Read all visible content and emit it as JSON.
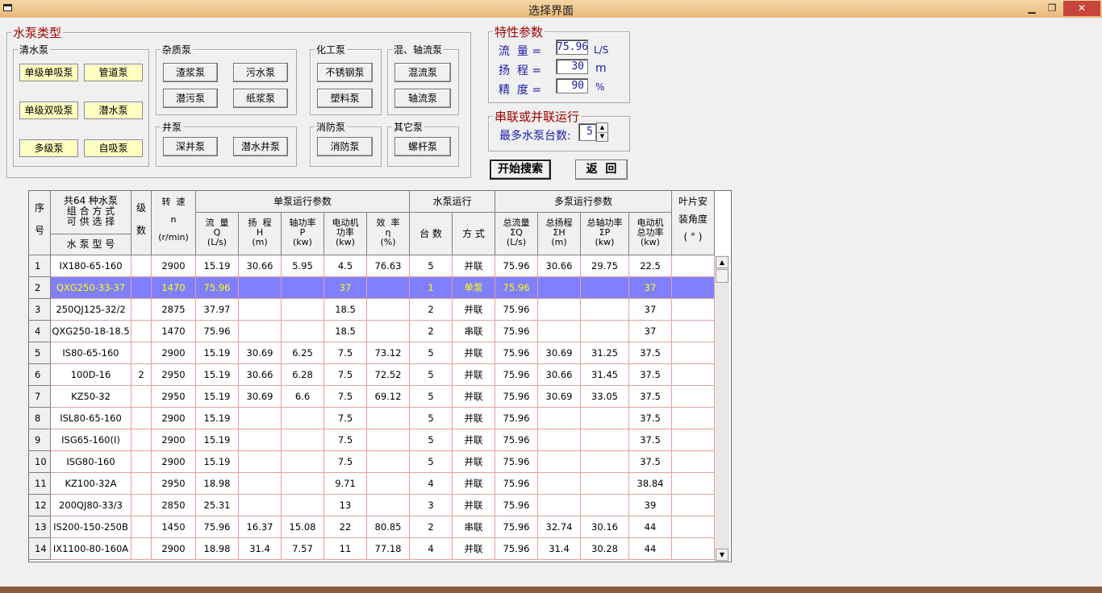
{
  "window": {
    "title": "选择界面",
    "min": "▁",
    "max": "❐",
    "close": "✕"
  },
  "pump_types": {
    "title": "水泵类型",
    "clean": {
      "title": "清水泵",
      "buttons": [
        "单级单吸泵",
        "管道泵",
        "单级双吸泵",
        "潜水泵",
        "多级泵",
        "自吸泵"
      ]
    },
    "impurity": {
      "title": "杂质泵",
      "buttons": [
        "渣浆泵",
        "污水泵",
        "潜污泵",
        "纸浆泵"
      ]
    },
    "chemical": {
      "title": "化工泵",
      "buttons": [
        "不锈钢泵",
        "塑料泵"
      ]
    },
    "mixed": {
      "title": "混、轴流泵",
      "buttons": [
        "混流泵",
        "轴流泵"
      ]
    },
    "well": {
      "title": "井泵",
      "buttons": [
        "深井泵",
        "潜水井泵"
      ]
    },
    "fire": {
      "title": "消防泵",
      "buttons": [
        "消防泵"
      ]
    },
    "other": {
      "title": "其它泵",
      "buttons": [
        "螺杆泵"
      ]
    }
  },
  "params": {
    "title": "特性参数",
    "flow": {
      "label": "流  量 =",
      "value": "75.96",
      "unit": "L/S"
    },
    "head": {
      "label": "扬  程 =",
      "value": "30",
      "unit": "m"
    },
    "precision": {
      "label": "精  度 =",
      "value": "90",
      "unit": "%"
    }
  },
  "series": {
    "title": "串联或并联运行",
    "label": "最多水泵台数:",
    "value": "5"
  },
  "actions": {
    "search": "开始搜索",
    "back": "返  回"
  },
  "grid": {
    "h_seq": "序\n\n号",
    "h_combo": "共64 种水泵\n组 合 方 式\n可 供 选 择",
    "h_model": "水 泵 型 号",
    "h_stage": "级\n\n数",
    "h_speed": "转  速\n\nn\n\n(r/min)",
    "h_single": "单泵运行参数",
    "h_flow": "流  量\nQ\n(L/s)",
    "h_head": "扬  程\nH\n(m)",
    "h_shaft": "轴功率\nP\n(kw)",
    "h_motor": "电动机\n功率\n(kw)",
    "h_eff": "效  率\nη\n(%)",
    "h_run": "水泵运行",
    "h_count": "台  数",
    "h_mode": "方  式",
    "h_multi": "多泵运行参数",
    "h_tflow": "总流量\nΣQ\n(L/s)",
    "h_thead": "总扬程\nΣH\n(m)",
    "h_tshaft": "总轴功率\nΣP\n(kw)",
    "h_tmotor": "电动机\n总功率\n(kw)",
    "h_blade": "叶片安\n\n装角度\n\n( ° )",
    "rows": [
      [
        "1",
        "IX180-65-160",
        "",
        "2900",
        "15.19",
        "30.66",
        "5.95",
        "4.5",
        "76.63",
        "5",
        "并联",
        "75.96",
        "30.66",
        "29.75",
        "22.5",
        ""
      ],
      [
        "2",
        "QXG250-33-37",
        "",
        "1470",
        "75.96",
        "",
        "",
        "37",
        "",
        "1",
        "单泵",
        "75.96",
        "",
        "",
        "37",
        ""
      ],
      [
        "3",
        "250QJ125-32/2",
        "",
        "2875",
        "37.97",
        "",
        "",
        "18.5",
        "",
        "2",
        "并联",
        "75.96",
        "",
        "",
        "37",
        ""
      ],
      [
        "4",
        "QXG250-18-18.5",
        "",
        "1470",
        "75.96",
        "",
        "",
        "18.5",
        "",
        "2",
        "串联",
        "75.96",
        "",
        "",
        "37",
        ""
      ],
      [
        "5",
        "IS80-65-160",
        "",
        "2900",
        "15.19",
        "30.69",
        "6.25",
        "7.5",
        "73.12",
        "5",
        "并联",
        "75.96",
        "30.69",
        "31.25",
        "37.5",
        ""
      ],
      [
        "6",
        "100D-16",
        "2",
        "2950",
        "15.19",
        "30.66",
        "6.28",
        "7.5",
        "72.52",
        "5",
        "并联",
        "75.96",
        "30.66",
        "31.45",
        "37.5",
        ""
      ],
      [
        "7",
        "KZ50-32",
        "",
        "2950",
        "15.19",
        "30.69",
        "6.6",
        "7.5",
        "69.12",
        "5",
        "并联",
        "75.96",
        "30.69",
        "33.05",
        "37.5",
        ""
      ],
      [
        "8",
        "ISL80-65-160",
        "",
        "2900",
        "15.19",
        "",
        "",
        "7.5",
        "",
        "5",
        "并联",
        "75.96",
        "",
        "",
        "37.5",
        ""
      ],
      [
        "9",
        "ISG65-160(I)",
        "",
        "2900",
        "15.19",
        "",
        "",
        "7.5",
        "",
        "5",
        "并联",
        "75.96",
        "",
        "",
        "37.5",
        ""
      ],
      [
        "10",
        "ISG80-160",
        "",
        "2900",
        "15.19",
        "",
        "",
        "7.5",
        "",
        "5",
        "并联",
        "75.96",
        "",
        "",
        "37.5",
        ""
      ],
      [
        "11",
        "KZ100-32A",
        "",
        "2950",
        "18.98",
        "",
        "",
        "9.71",
        "",
        "4",
        "并联",
        "75.96",
        "",
        "",
        "38.84",
        ""
      ],
      [
        "12",
        "200QJ80-33/3",
        "",
        "2850",
        "25.31",
        "",
        "",
        "13",
        "",
        "3",
        "并联",
        "75.96",
        "",
        "",
        "39",
        ""
      ],
      [
        "13",
        "IS200-150-250B",
        "",
        "1450",
        "75.96",
        "16.37",
        "15.08",
        "22",
        "80.85",
        "2",
        "串联",
        "75.96",
        "32.74",
        "30.16",
        "44",
        ""
      ],
      [
        "14",
        "IX1100-80-160A",
        "",
        "2900",
        "18.98",
        "31.4",
        "7.57",
        "11",
        "77.18",
        "4",
        "并联",
        "75.96",
        "31.4",
        "30.28",
        "44",
        ""
      ]
    ],
    "selected_row": 2,
    "scroll_up": "▲",
    "scroll_down": "▼"
  }
}
